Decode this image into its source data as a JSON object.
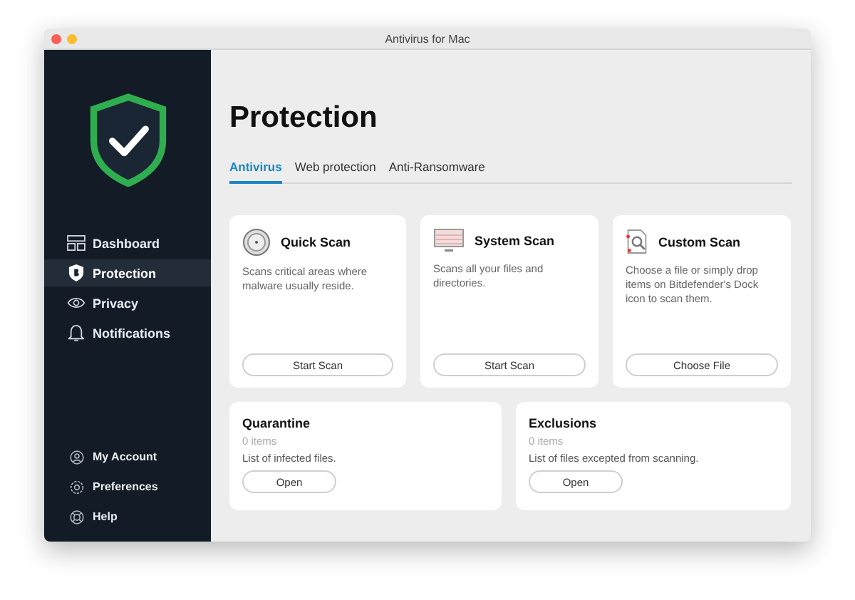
{
  "window": {
    "title": "Antivirus for Mac"
  },
  "sidebar": {
    "items": [
      {
        "label": "Dashboard",
        "selected": false
      },
      {
        "label": "Protection",
        "selected": true
      },
      {
        "label": "Privacy",
        "selected": false
      },
      {
        "label": "Notifications",
        "selected": false
      }
    ],
    "footer_items": [
      {
        "label": "My Account"
      },
      {
        "label": "Preferences"
      },
      {
        "label": "Help"
      }
    ]
  },
  "page": {
    "title": "Protection"
  },
  "tabs": [
    {
      "label": "Antivirus",
      "selected": true
    },
    {
      "label": "Web protection",
      "selected": false
    },
    {
      "label": "Anti-Ransomware",
      "selected": false
    }
  ],
  "scan_cards": [
    {
      "title": "Quick Scan",
      "description": "Scans critical areas where malware usually reside.",
      "button": "Start Scan"
    },
    {
      "title": "System Scan",
      "description": "Scans all your files and directories.",
      "button": "Start Scan"
    },
    {
      "title": "Custom Scan",
      "description": "Choose a file or simply drop items on Bitdefender's Dock icon to scan them.",
      "button": "Choose File"
    }
  ],
  "list_cards": [
    {
      "title": "Quarantine",
      "count": "0 items",
      "description": "List of infected files.",
      "button": "Open"
    },
    {
      "title": "Exclusions",
      "count": "0 items",
      "description": "List of files excepted from scanning.",
      "button": "Open"
    }
  ]
}
